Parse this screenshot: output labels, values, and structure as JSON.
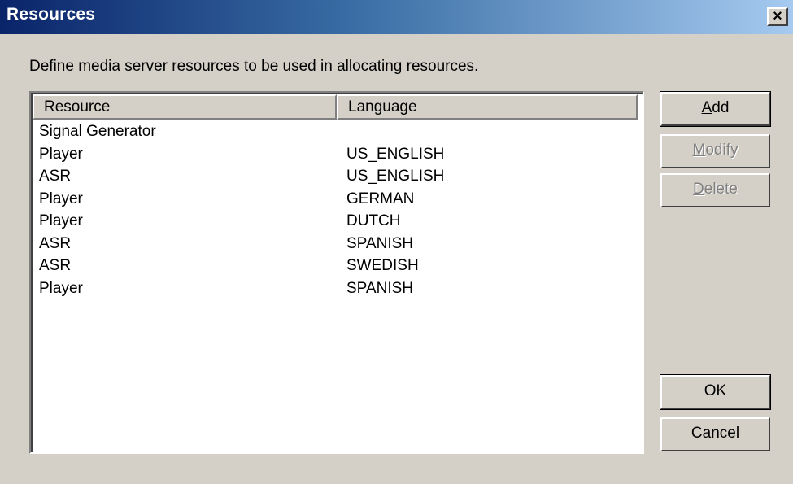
{
  "window": {
    "title": "Resources",
    "close_glyph": "×"
  },
  "description": "Define media server resources to be used in allocating resources.",
  "list": {
    "columns": [
      "Resource",
      "Language"
    ],
    "rows": [
      {
        "resource": "Signal Generator",
        "language": ""
      },
      {
        "resource": "Player",
        "language": "US_ENGLISH"
      },
      {
        "resource": "ASR",
        "language": "US_ENGLISH"
      },
      {
        "resource": "Player",
        "language": "GERMAN"
      },
      {
        "resource": "Player",
        "language": "DUTCH"
      },
      {
        "resource": "ASR",
        "language": "SPANISH"
      },
      {
        "resource": "ASR",
        "language": "SWEDISH"
      },
      {
        "resource": "Player",
        "language": "SPANISH"
      }
    ]
  },
  "buttons": {
    "add": {
      "mnemonic": "A",
      "rest": "dd",
      "enabled": true
    },
    "modify": {
      "mnemonic": "M",
      "rest": "odify",
      "enabled": false
    },
    "delete": {
      "mnemonic": "D",
      "rest": "elete",
      "enabled": false
    },
    "ok": {
      "label": "OK",
      "enabled": true
    },
    "cancel": {
      "label": "Cancel",
      "enabled": true
    }
  },
  "colors": {
    "title_gradient_start": "#0a246a",
    "title_gradient_end": "#a6caf0",
    "dialog_face": "#d4d0c8",
    "disabled_text": "#808080"
  }
}
